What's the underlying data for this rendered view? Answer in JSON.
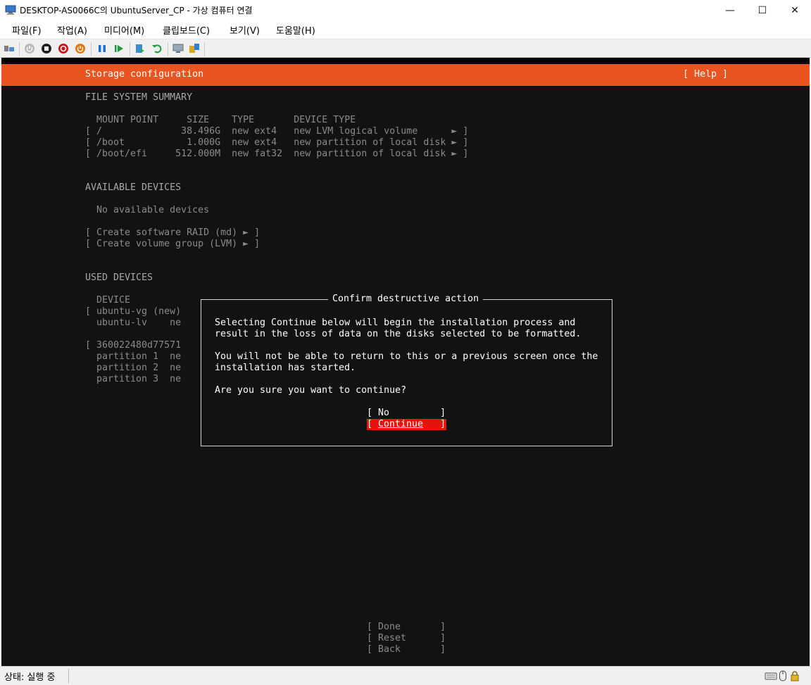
{
  "window": {
    "title": "DESKTOP-AS0066C의 UbuntuServer_CP - 가상 컴퓨터 연결",
    "minimize_glyph": "—",
    "maximize_glyph": "☐",
    "close_glyph": "✕"
  },
  "menu": {
    "items": [
      "파일(F)",
      "작업(A)",
      "미디어(M)",
      "클립보드(C)",
      "보기(V)",
      "도움말(H)"
    ]
  },
  "toolbar": {
    "icons": [
      "ctrl-alt-del-icon",
      "start-icon",
      "turn-off-icon",
      "shutdown-icon",
      "power-icon",
      "pause-icon",
      "resume-icon",
      "checkpoint-icon",
      "revert-icon",
      "enhanced-session-icon",
      "share-icon"
    ]
  },
  "installer": {
    "header_title": "Storage configuration",
    "help": "[ Help ]",
    "fs_summary_heading": "FILE SYSTEM SUMMARY",
    "fs_columns": "  MOUNT POINT     SIZE    TYPE       DEVICE TYPE",
    "fs_rows": [
      "[ /              38.496G  new ext4   new LVM logical volume      ► ]",
      "[ /boot           1.000G  new ext4   new partition of local disk ► ]",
      "[ /boot/efi     512.000M  new fat32  new partition of local disk ► ]"
    ],
    "available_heading": "AVAILABLE DEVICES",
    "no_devices": "  No available devices",
    "create_raid": "[ Create software RAID (md) ► ]",
    "create_lvm": "[ Create volume group (LVM) ► ]",
    "used_heading": "USED DEVICES",
    "used_rows": [
      "  DEVICE",
      "[ ubuntu-vg (new)",
      "  ubuntu-lv    ne",
      "",
      "[ 360022480d77571",
      "  partition 1  ne",
      "  partition 2  ne",
      "  partition 3  ne"
    ],
    "bottom_buttons": [
      "[ Done       ]",
      "[ Reset      ]",
      "[ Back       ]"
    ]
  },
  "dialog": {
    "title": "Confirm destructive action",
    "para1_line1": "Selecting Continue below will begin the installation process and",
    "para1_line2": "result in the loss of data on the disks selected to be formatted.",
    "para2_line1": "You will not be able to return to this or a previous screen once the",
    "para2_line2": "installation has started.",
    "question": "Are you sure you want to continue?",
    "no_button": {
      "open": "[ ",
      "label": "No",
      "close": "         ]"
    },
    "continue_button": {
      "open": "[ ",
      "label": "Continue",
      "close": "   ]",
      "focused": true
    }
  },
  "status": {
    "text": "상태: 실행 중"
  },
  "colors": {
    "header": "#e95420",
    "focus": "#e8120c",
    "console_bg": "#121212"
  }
}
